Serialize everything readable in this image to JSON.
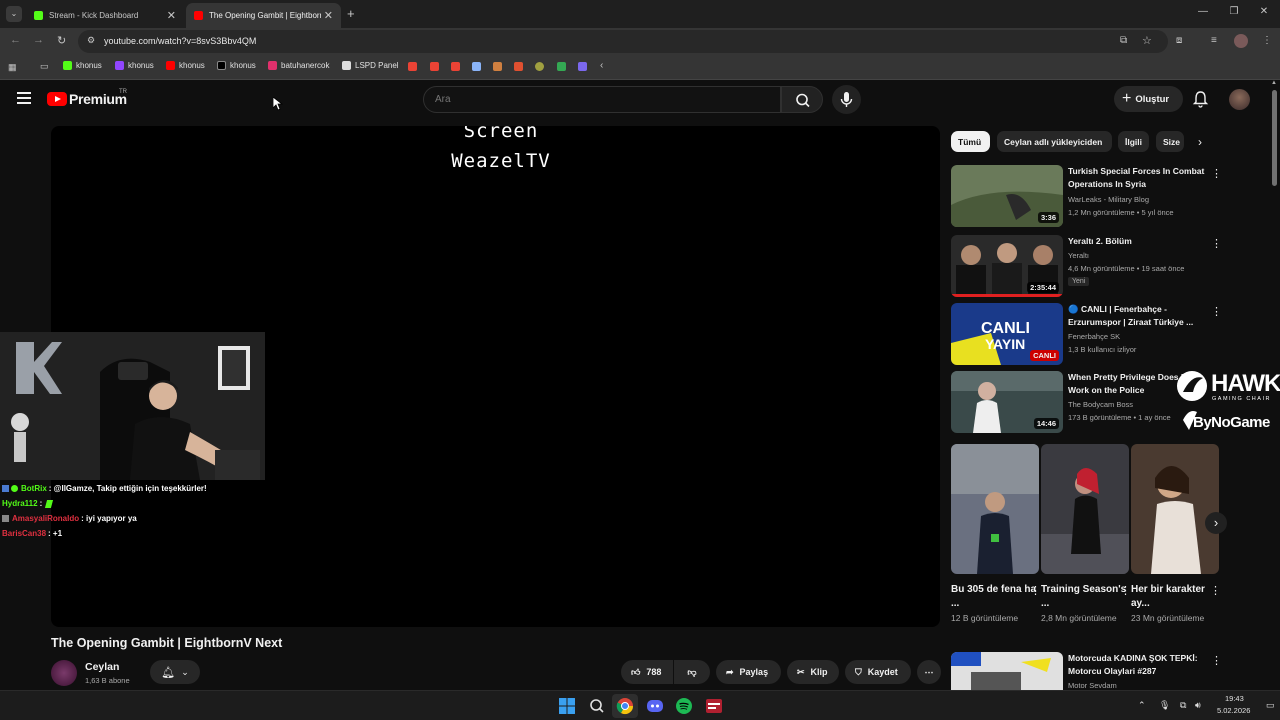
{
  "browser": {
    "tabs": [
      {
        "title": "Stream - Kick Dashboard",
        "favicon_color": "#53fc18"
      },
      {
        "title": "The Opening Gambit | Eightborn",
        "favicon_color": "#ff0000"
      }
    ],
    "url": "youtube.com/watch?v=8svS3Bbv4QM",
    "bookmarks": [
      {
        "label": "khonus",
        "color": "#53fc18"
      },
      {
        "label": "khonus",
        "color": "#9146ff"
      },
      {
        "label": "khonus",
        "color": "#ff0000"
      },
      {
        "label": "khonus",
        "color": "#ffffff"
      },
      {
        "label": "batuhanercok",
        "color": "#e1306c"
      },
      {
        "label": "LSPD Panel",
        "color": "#ffffff"
      }
    ]
  },
  "youtube": {
    "logo_text": "Premium",
    "logo_region": "TR",
    "search_placeholder": "Ara",
    "create_label": "Oluştur"
  },
  "player": {
    "screen_line1": "Screen",
    "screen_line2": "WeazelTV"
  },
  "chat": [
    {
      "user": "BotRix",
      "user_color": "#53fc18",
      "message": ": @IlGamze, Takip ettiğin için teşekkürler!"
    },
    {
      "user": "Hydra112",
      "user_color": "#53fc18",
      "message": ":"
    },
    {
      "user": "AmasyaliRonaldo",
      "user_color": "#e03040",
      "message": ": iyi yapıyor ya"
    },
    {
      "user": "BarisCan38",
      "user_color": "#e03040",
      "message": ": +1"
    }
  ],
  "video": {
    "title": "The Opening Gambit | EightbornV Next",
    "channel": "Ceylan",
    "subscribers": "1,63 B abone",
    "likes": "788",
    "share_label": "Paylaş",
    "clip_label": "Klip",
    "save_label": "Kaydet"
  },
  "chips": [
    "Tümü",
    "Ceylan adlı yükleyiciden",
    "İlgili",
    "Size"
  ],
  "recommendations": [
    {
      "title": "Turkish Special Forces In Combat Operations In Syria",
      "channel": "WarLeaks - Military Blog",
      "meta": "1,2 Mn görüntüleme • 5 yıl önce",
      "duration": "3:36",
      "badge": ""
    },
    {
      "title": "Yeraltı 2. Bölüm",
      "channel": "Yeraltı",
      "meta": "4,6 Mn görüntüleme • 19 saat önce",
      "duration": "2:35:44",
      "badge": "Yeni"
    },
    {
      "title": "🔵 CANLI | Fenerbahçe - Erzurumspor | Ziraat Türkiye ...",
      "channel": "Fenerbahçe SK",
      "meta": "1,3 B kullanıcı izliyor",
      "duration": "CANLI",
      "badge": ""
    },
    {
      "title": "When Pretty Privilege Does NOT Work on the Police",
      "channel": "The Bodycam Boss",
      "meta": "173 B görüntüleme • 1 ay önce",
      "duration": "14:46",
      "badge": ""
    },
    {
      "title": "Motorcuda KADINA ŞOK TEPKİ: Motorcu Olaylari #287",
      "channel": "Motor Sevdam",
      "meta": "",
      "duration": "",
      "badge": ""
    }
  ],
  "shorts": [
    {
      "title": "Bu 305 de fena ha ...",
      "views": "12 B görüntüleme"
    },
    {
      "title": "Training Season's ...",
      "views": "2,8 Mn görüntüleme"
    },
    {
      "title": "Her bir karakter ay...",
      "views": "23 Mn görüntüleme"
    }
  ],
  "overlay": {
    "hawk_text": "HAWK",
    "hawk_sub": "GAMING CHAIR",
    "sponsor": "ByNoGame"
  },
  "taskbar": {
    "time": "19:43",
    "date": "5.02.2026"
  }
}
